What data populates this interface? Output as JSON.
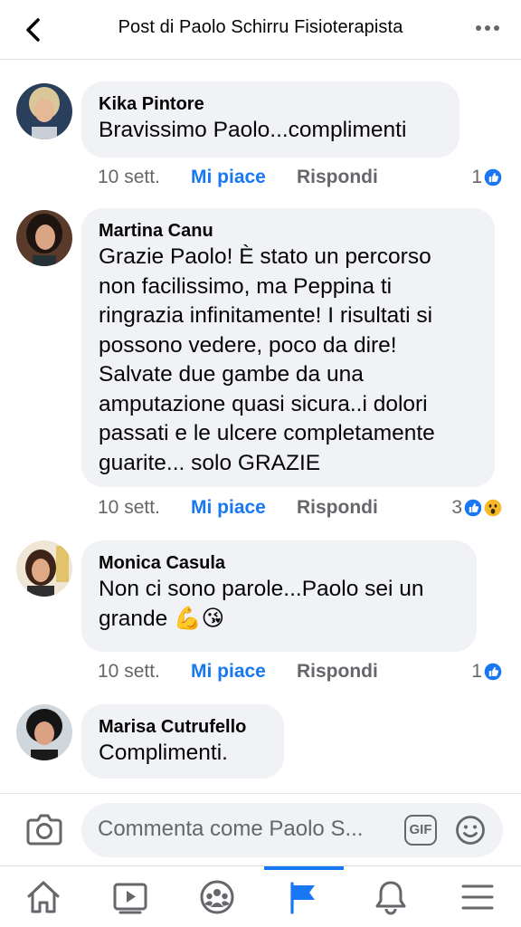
{
  "header": {
    "title": "Post di Paolo Schirru Fisioterapista"
  },
  "comments": [
    {
      "author": "Kika Pintore",
      "text": "Bravissimo Paolo...complimenti",
      "time": "10 sett.",
      "like": "Mi piace",
      "reply": "Rispondi",
      "reaction_count": "1",
      "reactions": [
        "like"
      ]
    },
    {
      "author": "Martina Canu",
      "text": "Grazie Paolo! È stato un percorso\nnon facilissimo, ma Peppina ti\nringrazia infinitamente! I risultati si\npossono vedere, poco da dire!\nSalvate due gambe da una\namputazione quasi sicura..i dolori\npassati e le ulcere completamente\nguarite... solo GRAZIE",
      "time": "10 sett.",
      "like": "Mi piace",
      "reply": "Rispondi",
      "reaction_count": "3",
      "reactions": [
        "like",
        "wow"
      ]
    },
    {
      "author": "Monica Casula",
      "text": "Non ci sono parole...Paolo sei un\ngrande 💪😘",
      "time": "10 sett.",
      "like": "Mi piace",
      "reply": "Rispondi",
      "reaction_count": "1",
      "reactions": [
        "like"
      ]
    },
    {
      "author": "Marisa Cutrufello",
      "text": "Complimenti."
    }
  ],
  "composer": {
    "placeholder": "Commenta come Paolo S...",
    "gif_label": "GIF"
  },
  "tabs": [
    {
      "icon": "home-icon"
    },
    {
      "icon": "video-icon"
    },
    {
      "icon": "groups-icon"
    },
    {
      "icon": "pages-flag-icon",
      "active": true
    },
    {
      "icon": "bell-icon"
    },
    {
      "icon": "menu-icon"
    }
  ],
  "colors": {
    "accent": "#1877f2",
    "bubble": "#f0f2f5",
    "secondary_text": "#65676b",
    "wow": "#f7b928"
  }
}
